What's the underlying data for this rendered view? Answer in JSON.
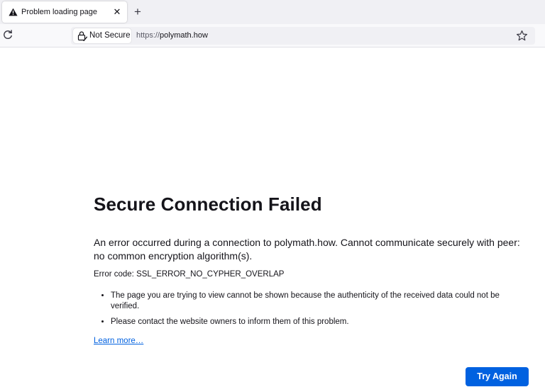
{
  "tab": {
    "title": "Problem loading page",
    "close_glyph": "✕",
    "warning_icon": "warning-icon",
    "new_tab_glyph": "+"
  },
  "navbar": {
    "reload_icon": "reload-icon",
    "security_label": "Not Secure",
    "url_scheme": "https://",
    "url_host": "polymath.how",
    "bookmark_icon": "star-icon"
  },
  "error": {
    "title": "Secure Connection Failed",
    "description": "An error occurred during a connection to polymath.how. Cannot communicate securely with peer: no common encryption algorithm(s).",
    "code": "Error code: SSL_ERROR_NO_CYPHER_OVERLAP",
    "advice": [
      "The page you are trying to view cannot be shown because the authenticity of the received data could not be verified.",
      "Please contact the website owners to inform them of this problem."
    ],
    "learn_more": "Learn more…",
    "try_again": "Try Again"
  },
  "colors": {
    "accent": "#0061e0",
    "tabstrip_bg": "#f0f0f4",
    "text": "#15141a"
  }
}
